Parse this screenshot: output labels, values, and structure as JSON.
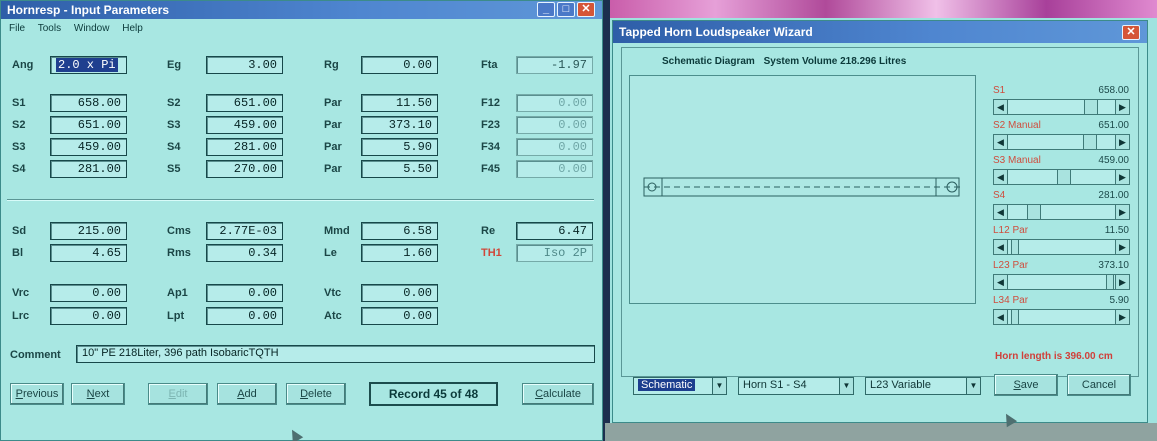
{
  "main_window": {
    "title": "Hornresp - Input Parameters",
    "menu": [
      "File",
      "Tools",
      "Window",
      "Help"
    ],
    "fields": {
      "ang": {
        "label": "Ang",
        "value": "2.0 x Pi"
      },
      "eg": {
        "label": "Eg",
        "value": "3.00"
      },
      "rg": {
        "label": "Rg",
        "value": "0.00"
      },
      "fta": {
        "label": "Fta",
        "value": "-1.97"
      },
      "s1": {
        "label": "S1",
        "value": "658.00"
      },
      "s2": {
        "label": "S2",
        "value": "651.00"
      },
      "s3": {
        "label": "S3",
        "value": "459.00"
      },
      "s4": {
        "label": "S4",
        "value": "281.00"
      },
      "s2b": {
        "label": "S2",
        "value": "651.00"
      },
      "s3b": {
        "label": "S3",
        "value": "459.00"
      },
      "s4b": {
        "label": "S4",
        "value": "281.00"
      },
      "s5": {
        "label": "S5",
        "value": "270.00"
      },
      "par1": {
        "label": "Par",
        "value": "11.50"
      },
      "par2": {
        "label": "Par",
        "value": "373.10"
      },
      "par3": {
        "label": "Par",
        "value": "5.90"
      },
      "par4": {
        "label": "Par",
        "value": "5.50"
      },
      "f12": {
        "label": "F12",
        "value": "0.00"
      },
      "f23": {
        "label": "F23",
        "value": "0.00"
      },
      "f34": {
        "label": "F34",
        "value": "0.00"
      },
      "f45": {
        "label": "F45",
        "value": "0.00"
      },
      "sd": {
        "label": "Sd",
        "value": "215.00"
      },
      "cms": {
        "label": "Cms",
        "value": "2.77E-03"
      },
      "mmd": {
        "label": "Mmd",
        "value": "6.58"
      },
      "re": {
        "label": "Re",
        "value": "6.47"
      },
      "bl": {
        "label": "Bl",
        "value": "4.65"
      },
      "rms": {
        "label": "Rms",
        "value": "0.34"
      },
      "le": {
        "label": "Le",
        "value": "1.60"
      },
      "th1": {
        "label": "TH1",
        "value": "Iso 2P"
      },
      "vrc": {
        "label": "Vrc",
        "value": "0.00"
      },
      "ap1": {
        "label": "Ap1",
        "value": "0.00"
      },
      "vtc": {
        "label": "Vtc",
        "value": "0.00"
      },
      "lrc": {
        "label": "Lrc",
        "value": "0.00"
      },
      "lpt": {
        "label": "Lpt",
        "value": "0.00"
      },
      "atc": {
        "label": "Atc",
        "value": "0.00"
      }
    },
    "comment": {
      "label": "Comment",
      "value": "10\" PE 218Liter, 396 path IsobaricTQTH"
    },
    "buttons": {
      "previous": "Previous",
      "next": "Next",
      "edit": "Edit",
      "add": "Add",
      "delete": "Delete",
      "calculate": "Calculate"
    },
    "record": "Record 45 of 48"
  },
  "wizard": {
    "title": "Tapped Horn Loudspeaker Wizard",
    "schematic_label": "Schematic Diagram",
    "system_volume": "System Volume 218.296 Litres",
    "sliders": [
      {
        "label": "S1",
        "value": "658.00",
        "position": 0.82
      },
      {
        "label": "S2 Manual",
        "value": "651.00",
        "position": 0.81
      },
      {
        "label": "S3 Manual",
        "value": "459.00",
        "position": 0.47
      },
      {
        "label": "S4",
        "value": "281.00",
        "position": 0.22
      },
      {
        "label": "L12 Par",
        "value": "11.50",
        "position": 0.02
      },
      {
        "label": "L23 Par",
        "value": "373.10",
        "position": 0.96
      },
      {
        "label": "L34 Par",
        "value": "5.90",
        "position": 0.02
      }
    ],
    "horn_length": "Horn length is 396.00 cm",
    "dropdowns": {
      "view": "Schematic",
      "horn": "Horn S1 - S4",
      "variable": "L23 Variable"
    },
    "buttons": {
      "save": "Save",
      "cancel": "Cancel"
    }
  }
}
